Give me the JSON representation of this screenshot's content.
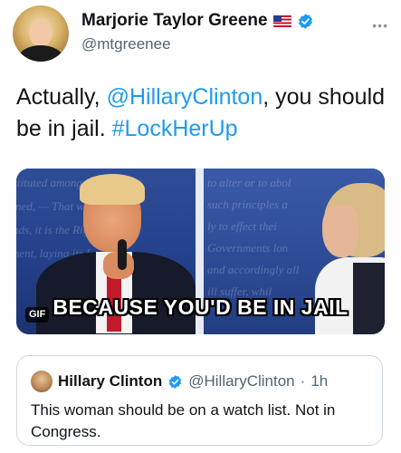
{
  "tweet": {
    "author": {
      "name": "Marjorie Taylor Greene",
      "handle": "@mtgreenee"
    },
    "more_menu": "•••",
    "text_parts": [
      "Actually, ",
      "@HillaryClinton",
      ", you should be in jail. ",
      "#LockHerUp"
    ],
    "media": {
      "caption": "BECAUSE YOU'D BE IN JAIL",
      "badge": "GIF",
      "background_text_left": [
        "stituted among Men, der",
        "rned, — That whenever",
        "nds, it is the Right of the",
        "ment, laying its foundatio"
      ],
      "background_text_right": [
        "to alter or to abol",
        "such principles a",
        "ly to effect thei",
        "Governments lon",
        "and accordingly all",
        "ill suffer, whil"
      ]
    }
  },
  "quoted_tweet": {
    "name": "Hillary Clinton",
    "handle": "@HillaryClinton",
    "separator": "·",
    "time": "1h",
    "text": "This woman should be on a watch list. Not in Congress."
  },
  "colors": {
    "link": "#1d9bf0",
    "verified": "#1d9bf0",
    "secondary_text": "#536471",
    "border": "#cfd9de"
  },
  "icons": {
    "verified": "verified-badge-icon",
    "flag": "us-flag-icon",
    "more": "more-options-icon"
  }
}
